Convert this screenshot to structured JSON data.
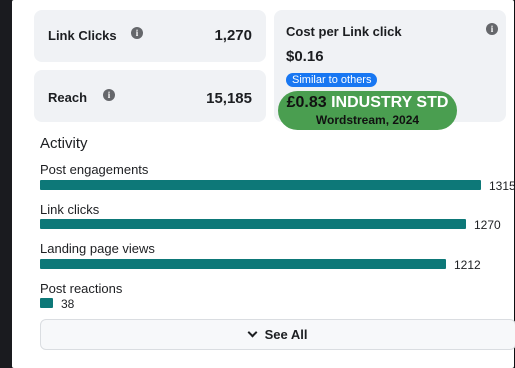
{
  "cards": {
    "link_clicks": {
      "label": "Link Clicks",
      "value": "1,270",
      "icon": "info-icon"
    },
    "reach": {
      "label": "Reach",
      "value": "15,185",
      "icon": "info-icon"
    },
    "cost_per_link_click": {
      "label": "Cost per Link click",
      "value": "$0.16",
      "badge": "Similar to others",
      "icon": "info-icon"
    }
  },
  "industry": {
    "price": "£0.83",
    "label": "INDUSTRY STD",
    "source": "Wordstream, 2024"
  },
  "activity": {
    "title": "Activity",
    "metrics": [
      {
        "label": "Post engagements",
        "value": "1315",
        "amount": 1315
      },
      {
        "label": "Link clicks",
        "value": "1270",
        "amount": 1270
      },
      {
        "label": "Landing page views",
        "value": "1212",
        "amount": 1212
      },
      {
        "label": "Post reactions",
        "value": "38",
        "amount": 38
      }
    ],
    "see_all": "See All"
  },
  "colors": {
    "bar": "#0d7878",
    "badge": "#1877f2",
    "industry_pill": "#4a9e50"
  }
}
